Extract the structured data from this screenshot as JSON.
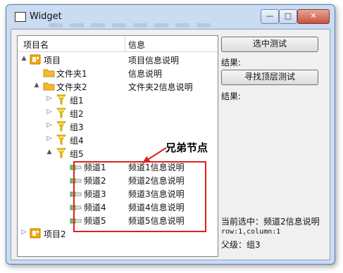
{
  "window": {
    "title": "Widget"
  },
  "tree": {
    "headers": [
      "项目名",
      "信息"
    ],
    "rows": [
      {
        "name": "项目",
        "info": "项目信息说明",
        "icon": "project-icon",
        "arrow": "▲",
        "level": 0
      },
      {
        "name": "文件夹1",
        "info": "信息说明",
        "icon": "folder-icon",
        "arrow": "",
        "level": 1
      },
      {
        "name": "文件夹2",
        "info": "文件夹2信息说明",
        "icon": "folder-icon",
        "arrow": "▲",
        "level": 1
      },
      {
        "name": "组1",
        "info": "",
        "icon": "funnel-icon",
        "arrow": "▷",
        "level": 2
      },
      {
        "name": "组2",
        "info": "",
        "icon": "funnel-icon",
        "arrow": "▷",
        "level": 2
      },
      {
        "name": "组3",
        "info": "",
        "icon": "funnel-icon",
        "arrow": "▷",
        "level": 2
      },
      {
        "name": "组4",
        "info": "",
        "icon": "funnel-icon",
        "arrow": "▷",
        "level": 2
      },
      {
        "name": "组5",
        "info": "",
        "icon": "funnel-icon",
        "arrow": "▲",
        "level": 2
      },
      {
        "name": "频道1",
        "info": "频道1信息说明",
        "icon": "channel-icon",
        "arrow": "",
        "level": 3
      },
      {
        "name": "频道2",
        "info": "频道2信息说明",
        "icon": "channel-icon",
        "arrow": "",
        "level": 3
      },
      {
        "name": "频道3",
        "info": "频道3信息说明",
        "icon": "channel-icon",
        "arrow": "",
        "level": 3
      },
      {
        "name": "频道4",
        "info": "频道4信息说明",
        "icon": "channel-icon",
        "arrow": "",
        "level": 3
      },
      {
        "name": "频道5",
        "info": "频道5信息说明",
        "icon": "channel-icon",
        "arrow": "",
        "level": 3
      },
      {
        "name": "项目2",
        "info": "",
        "icon": "project-icon",
        "arrow": "▷",
        "level": 0
      }
    ]
  },
  "panel": {
    "select_test_label": "选中测试",
    "result1_label": "结果:",
    "find_top_test_label": "寻找顶层测试",
    "result2_label": "结果:",
    "current_selected": "当前选中：频道2信息说明",
    "row_col": "row:1,column:1",
    "parent": "父级：组3"
  },
  "annotation": {
    "text": "兄弟节点",
    "color": "#e0201f"
  }
}
